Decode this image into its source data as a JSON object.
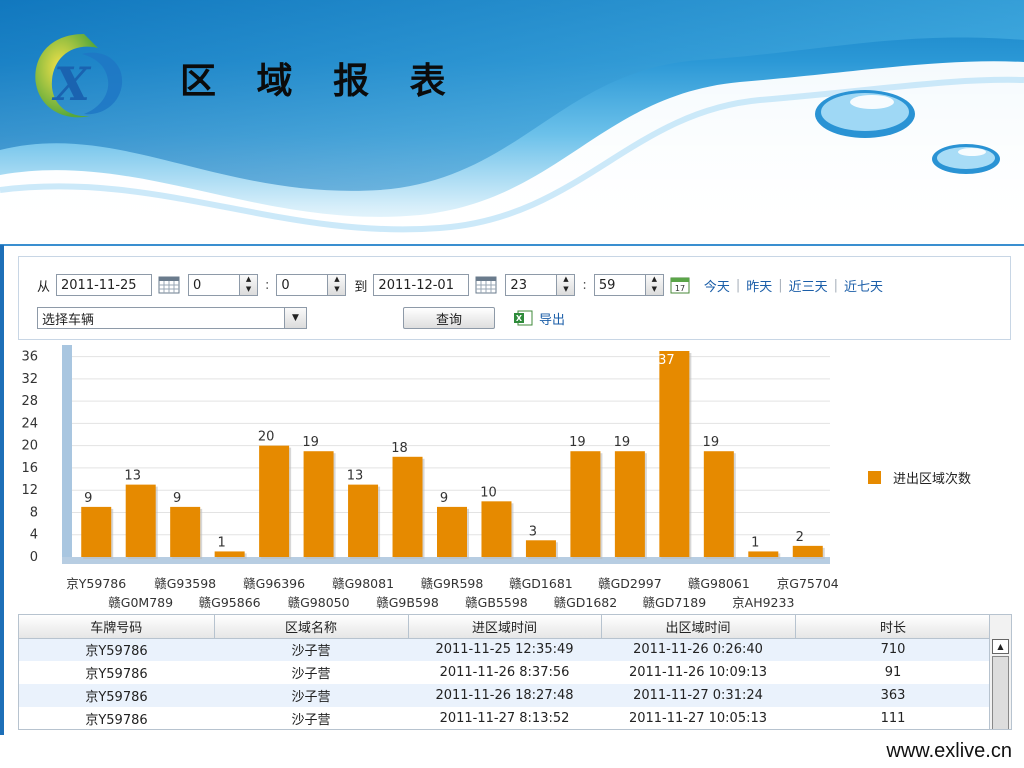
{
  "banner": {
    "title": "区 域 报 表",
    "logo_icon": "exlive-x-logo-icon"
  },
  "query": {
    "from_label": "从",
    "from_date": "2011-11-25",
    "from_hour": "0",
    "from_minute": "0",
    "to_label": "到",
    "to_date": "2011-12-01",
    "to_hour": "23",
    "to_minute": "59",
    "colon": ":",
    "quick_links": [
      "今天",
      "昨天",
      "近三天",
      "近七天"
    ],
    "separator": "|",
    "vehicle_select": "选择车辆",
    "search_button": "查询",
    "export_link": "导出"
  },
  "chart_data": {
    "type": "bar",
    "categories_row1": [
      "京Y59786",
      "赣G93598",
      "赣G96396",
      "赣G98081",
      "赣G9R598",
      "赣GD1681",
      "赣GD2997",
      "赣G98061",
      "京G75704"
    ],
    "categories_row2": [
      "赣G0M789",
      "赣G95866",
      "赣G98050",
      "赣G9B598",
      "赣GB5598",
      "赣GD1682",
      "赣GD7189",
      "京AH9233"
    ],
    "values": [
      9,
      13,
      9,
      1,
      20,
      19,
      13,
      18,
      9,
      10,
      3,
      19,
      19,
      37,
      19,
      1,
      2
    ],
    "series": [
      {
        "name": "进出区域次数",
        "color": "#e68a00"
      }
    ],
    "yticks": [
      0,
      4,
      8,
      12,
      16,
      20,
      24,
      28,
      32,
      36
    ],
    "ylim": [
      0,
      37
    ],
    "grid": true,
    "legend_position": "right"
  },
  "table": {
    "columns": [
      "车牌号码",
      "区域名称",
      "进区域时间",
      "出区域时间",
      "时长"
    ],
    "rows": [
      [
        "京Y59786",
        "沙子营",
        "2011-11-25 12:35:49",
        "2011-11-26 0:26:40",
        "710"
      ],
      [
        "京Y59786",
        "沙子营",
        "2011-11-26 8:37:56",
        "2011-11-26 10:09:13",
        "91"
      ],
      [
        "京Y59786",
        "沙子营",
        "2011-11-26 18:27:48",
        "2011-11-27 0:31:24",
        "363"
      ],
      [
        "京Y59786",
        "沙子营",
        "2011-11-27 8:13:52",
        "2011-11-27 10:05:13",
        "111"
      ]
    ]
  },
  "footer": {
    "url": "www.exlive.cn"
  },
  "colors": {
    "bar": "#e68a00",
    "accent": "#1b5ea8",
    "banner": "#2b98d6"
  }
}
